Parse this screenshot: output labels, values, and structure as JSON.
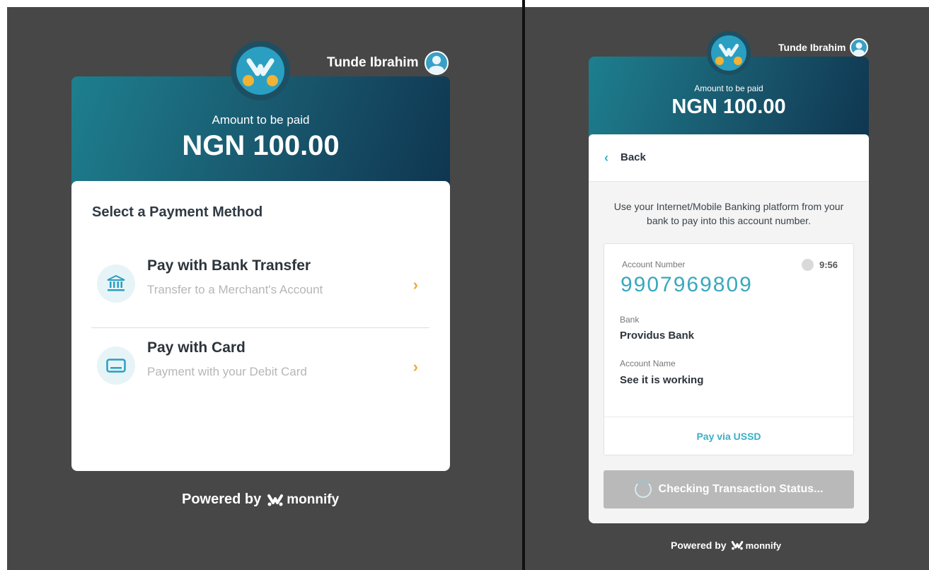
{
  "left": {
    "user_name": "Tunde Ibrahim",
    "amount_label": "Amount to be paid",
    "amount_value": "NGN 100.00",
    "section_title": "Select a Payment Method",
    "methods": [
      {
        "title": "Pay with Bank Transfer",
        "subtitle": "Transfer to a Merchant's Account",
        "icon": "bank-icon"
      },
      {
        "title": "Pay with Card",
        "subtitle": "Payment with your Debit Card",
        "icon": "card-icon"
      }
    ],
    "powered_by": "Powered by",
    "brand": "monnify"
  },
  "right": {
    "user_name": "Tunde Ibrahim",
    "amount_label": "Amount to be paid",
    "amount_value": "NGN 100.00",
    "back_label": "Back",
    "instructions": "Use your Internet/Mobile Banking platform from your bank to pay into this account number.",
    "account_number_label": "Account Number",
    "account_number": "9907969809",
    "timer": "9:56",
    "bank_label": "Bank",
    "bank_value": "Providus Bank",
    "account_name_label": "Account Name",
    "account_name_value": "See it is working",
    "ussd_label": "Pay via USSD",
    "status_label": "Checking Transaction Status...",
    "powered_by": "Powered by",
    "brand": "monnify"
  },
  "colors": {
    "accent": "#3ab0c4",
    "chevron": "#f2a93b",
    "backdrop": "#474747",
    "logo_dots": "#f2b233"
  }
}
